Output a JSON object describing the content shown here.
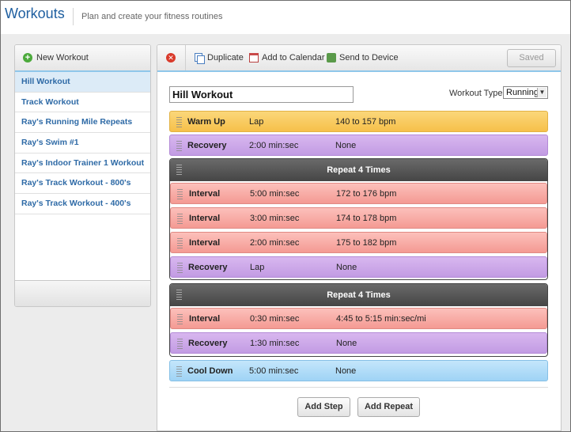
{
  "header": {
    "title": "Workouts",
    "subtitle": "Plan and create your fitness routines"
  },
  "sidebar": {
    "new_workout_label": "New Workout",
    "items": [
      {
        "label": "Hill Workout",
        "active": true
      },
      {
        "label": "Track Workout"
      },
      {
        "label": "Ray's Running Mile Repeats"
      },
      {
        "label": "Ray's Swim #1"
      },
      {
        "label": "Ray's Indoor Trainer 1 Workout"
      },
      {
        "label": "Ray's Track Workout - 800's"
      },
      {
        "label": "Ray's Track Workout - 400's"
      }
    ]
  },
  "toolbar": {
    "duplicate_label": "Duplicate",
    "calendar_label": "Add to Calendar",
    "device_label": "Send to Device",
    "saved_label": "Saved"
  },
  "workout": {
    "name": "Hill Workout",
    "type_label": "Workout Type:",
    "type_value": "Running"
  },
  "steps": {
    "warmup": {
      "name": "Warm Up",
      "duration": "Lap",
      "target": "140 to 157 bpm"
    },
    "recovery1": {
      "name": "Recovery",
      "duration": "2:00 min:sec",
      "target": "None"
    },
    "repeat1": {
      "label": "Repeat 4 Times",
      "steps": [
        {
          "name": "Interval",
          "duration": "5:00 min:sec",
          "target": "172 to 176 bpm"
        },
        {
          "name": "Interval",
          "duration": "3:00 min:sec",
          "target": "174 to 178 bpm"
        },
        {
          "name": "Interval",
          "duration": "2:00 min:sec",
          "target": "175 to 182 bpm"
        },
        {
          "name": "Recovery",
          "duration": "Lap",
          "target": "None"
        }
      ]
    },
    "repeat2": {
      "label": "Repeat 4 Times",
      "steps": [
        {
          "name": "Interval",
          "duration": "0:30 min:sec",
          "target": "4:45 to 5:15 min:sec/mi"
        },
        {
          "name": "Recovery",
          "duration": "1:30 min:sec",
          "target": "None"
        }
      ]
    },
    "cooldown": {
      "name": "Cool Down",
      "duration": "5:00 min:sec",
      "target": "None"
    }
  },
  "actions": {
    "add_step_label": "Add Step",
    "add_repeat_label": "Add Repeat"
  },
  "colors": {
    "warmup": "#f6c04a",
    "recovery": "#c29be3",
    "interval": "#f49a93",
    "cooldown": "#9fd3f5",
    "repeat_header": "#4f4f4f",
    "link": "#2e6aa6"
  }
}
